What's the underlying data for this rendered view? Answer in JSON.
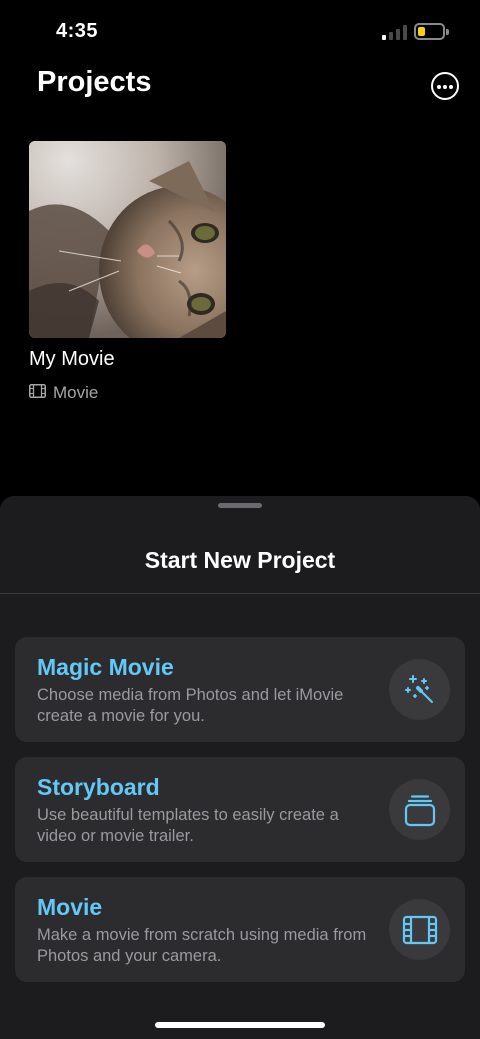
{
  "status_bar": {
    "time": "4:35",
    "battery_level": 0.2,
    "battery_color": "#f5d30a",
    "signal_bars_active": 1
  },
  "header": {
    "title": "Projects",
    "more_icon": "ellipsis-circle-icon"
  },
  "projects": [
    {
      "name": "My Movie",
      "type_label": "Movie",
      "type_icon": "film-icon",
      "thumbnail": "cat photo"
    }
  ],
  "sheet": {
    "title": "Start New Project",
    "options": [
      {
        "title": "Magic Movie",
        "description": "Choose media from Photos and let iMovie create a movie for you.",
        "icon": "magic-wand-icon"
      },
      {
        "title": "Storyboard",
        "description": "Use beautiful templates to easily create a video or movie trailer.",
        "icon": "stack-icon"
      },
      {
        "title": "Movie",
        "description": "Make a movie from scratch using media from Photos and your camera.",
        "icon": "film-icon"
      }
    ]
  },
  "colors": {
    "accent": "#64c8f7",
    "background": "#000000",
    "sheet_background": "#1c1c1e",
    "card_background": "#2c2c2e"
  }
}
